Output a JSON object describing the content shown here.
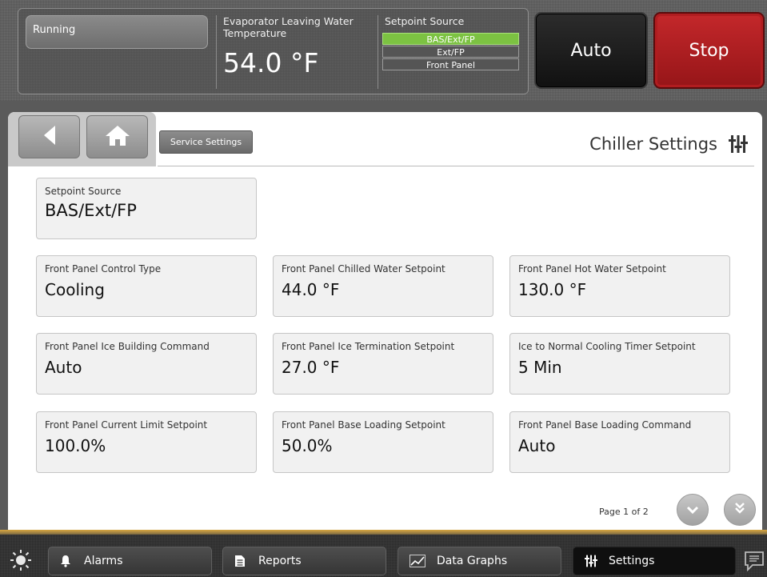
{
  "header": {
    "status": "Running",
    "evap_label": "Evaporator Leaving Water Temperature",
    "evap_value": "54.0 °F",
    "setpoint_source_label": "Setpoint Source",
    "setpoint_source_options": [
      "BAS/Ext/FP",
      "Ext/FP",
      "Front Panel"
    ],
    "setpoint_source_selected": "BAS/Ext/FP",
    "auto_label": "Auto",
    "stop_label": "Stop"
  },
  "nav": {
    "back_icon": "back-arrow-icon",
    "home_icon": "home-icon",
    "breadcrumb": "Service Settings",
    "page_title": "Chiller Settings",
    "title_icon": "settings-sliders-icon"
  },
  "tiles": [
    {
      "label": "Setpoint Source",
      "value": "BAS/Ext/FP"
    },
    {
      "label": "Front Panel Control Type",
      "value": "Cooling"
    },
    {
      "label": "Front Panel Chilled Water Setpoint",
      "value": "44.0 °F"
    },
    {
      "label": "Front Panel Hot Water Setpoint",
      "value": "130.0 °F"
    },
    {
      "label": "Front Panel Ice Building Command",
      "value": "Auto"
    },
    {
      "label": "Front Panel Ice Termination Setpoint",
      "value": "27.0 °F"
    },
    {
      "label": "Ice to Normal Cooling Timer Setpoint",
      "value": "5 Min"
    },
    {
      "label": "Front Panel Current Limit Setpoint",
      "value": "100.0%"
    },
    {
      "label": "Front Panel Base Loading Setpoint",
      "value": "50.0%"
    },
    {
      "label": "Front Panel Base Loading Command",
      "value": "Auto"
    }
  ],
  "pagination": {
    "text": "Page 1 of 2",
    "down_icon": "chevron-down-icon",
    "last_icon": "double-chevron-down-icon"
  },
  "bottom_nav": {
    "items": [
      {
        "label": "Alarms",
        "icon": "bell-icon"
      },
      {
        "label": "Reports",
        "icon": "document-icon"
      },
      {
        "label": "Data Graphs",
        "icon": "chart-icon"
      },
      {
        "label": "Settings",
        "icon": "settings-sliders-icon",
        "active": true
      }
    ],
    "brightness_icon": "sun-icon",
    "messages_icon": "chat-icon"
  },
  "colors": {
    "setpoint_active": "#7cc242",
    "stop_red": "#c4282b",
    "accent_bar": "#d8a640"
  }
}
